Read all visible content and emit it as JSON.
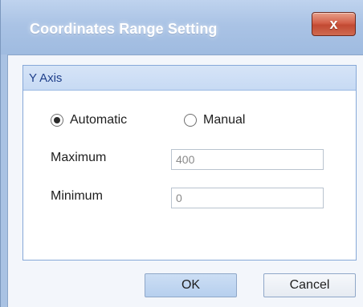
{
  "window": {
    "title": "Coordinates Range Setting",
    "close_label": "x"
  },
  "group": {
    "title": "Y Axis"
  },
  "mode": {
    "automatic_label": "Automatic",
    "manual_label": "Manual",
    "selected": "Automatic"
  },
  "fields": {
    "maximum_label": "Maximum",
    "maximum_value": "400",
    "minimum_label": "Minimum",
    "minimum_value": "0"
  },
  "buttons": {
    "ok_label": "OK",
    "cancel_label": "Cancel"
  }
}
